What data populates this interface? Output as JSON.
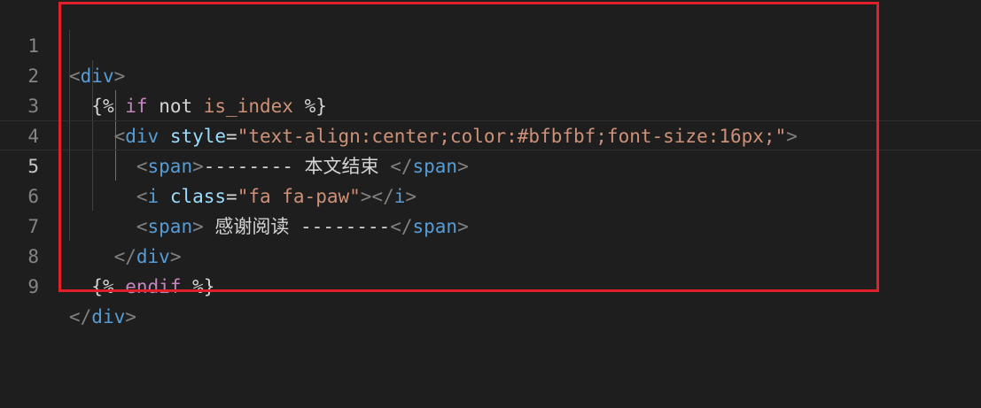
{
  "editor": {
    "line_numbers": [
      "1",
      "2",
      "3",
      "4",
      "5",
      "6",
      "7",
      "8",
      "9"
    ],
    "current_line": 5,
    "highlight_color": "#e0202a",
    "colors": {
      "background": "#1e1e1e",
      "punctuation": "#808080",
      "tag": "#569cd6",
      "attribute": "#9cdcfe",
      "string": "#ce9178",
      "keyword": "#c586c0",
      "text": "#d4d4d4"
    },
    "lines": [
      [
        {
          "t": "<",
          "c": "punctuation"
        },
        {
          "t": "div",
          "c": "tag"
        },
        {
          "t": ">",
          "c": "punctuation"
        }
      ],
      [
        {
          "t": "  ",
          "c": "text"
        },
        {
          "t": "{%",
          "c": "text"
        },
        {
          "t": " ",
          "c": "text"
        },
        {
          "t": "if",
          "c": "keyword"
        },
        {
          "t": " not ",
          "c": "text"
        },
        {
          "t": "is_index",
          "c": "string"
        },
        {
          "t": " %}",
          "c": "text"
        }
      ],
      [
        {
          "t": "    ",
          "c": "text"
        },
        {
          "t": "<",
          "c": "punctuation"
        },
        {
          "t": "div",
          "c": "tag"
        },
        {
          "t": " ",
          "c": "text"
        },
        {
          "t": "style",
          "c": "attribute"
        },
        {
          "t": "=",
          "c": "text"
        },
        {
          "t": "\"text-align:center;color:#bfbfbf;font-size:16px;\"",
          "c": "string"
        },
        {
          "t": ">",
          "c": "punctuation"
        }
      ],
      [
        {
          "t": "      ",
          "c": "text"
        },
        {
          "t": "<",
          "c": "punctuation"
        },
        {
          "t": "span",
          "c": "tag"
        },
        {
          "t": ">",
          "c": "punctuation"
        },
        {
          "t": "-------- 本文结束 ",
          "c": "text"
        },
        {
          "t": "</",
          "c": "punctuation"
        },
        {
          "t": "span",
          "c": "tag"
        },
        {
          "t": ">",
          "c": "punctuation"
        }
      ],
      [
        {
          "t": "      ",
          "c": "text"
        },
        {
          "t": "<",
          "c": "punctuation"
        },
        {
          "t": "i",
          "c": "tag"
        },
        {
          "t": " ",
          "c": "text"
        },
        {
          "t": "class",
          "c": "attribute"
        },
        {
          "t": "=",
          "c": "text"
        },
        {
          "t": "\"fa fa-paw\"",
          "c": "string"
        },
        {
          "t": "></",
          "c": "punctuation"
        },
        {
          "t": "i",
          "c": "tag"
        },
        {
          "t": ">",
          "c": "punctuation"
        }
      ],
      [
        {
          "t": "      ",
          "c": "text"
        },
        {
          "t": "<",
          "c": "punctuation"
        },
        {
          "t": "span",
          "c": "tag"
        },
        {
          "t": ">",
          "c": "punctuation"
        },
        {
          "t": " 感谢阅读 --------",
          "c": "text"
        },
        {
          "t": "</",
          "c": "punctuation"
        },
        {
          "t": "span",
          "c": "tag"
        },
        {
          "t": ">",
          "c": "punctuation"
        }
      ],
      [
        {
          "t": "    ",
          "c": "text"
        },
        {
          "t": "</",
          "c": "punctuation"
        },
        {
          "t": "div",
          "c": "tag"
        },
        {
          "t": ">",
          "c": "punctuation"
        }
      ],
      [
        {
          "t": "  ",
          "c": "text"
        },
        {
          "t": "{%",
          "c": "text"
        },
        {
          "t": " ",
          "c": "text"
        },
        {
          "t": "endif",
          "c": "keyword"
        },
        {
          "t": " %}",
          "c": "text"
        }
      ],
      [
        {
          "t": "</",
          "c": "punctuation"
        },
        {
          "t": "div",
          "c": "tag"
        },
        {
          "t": ">",
          "c": "punctuation"
        }
      ]
    ]
  }
}
